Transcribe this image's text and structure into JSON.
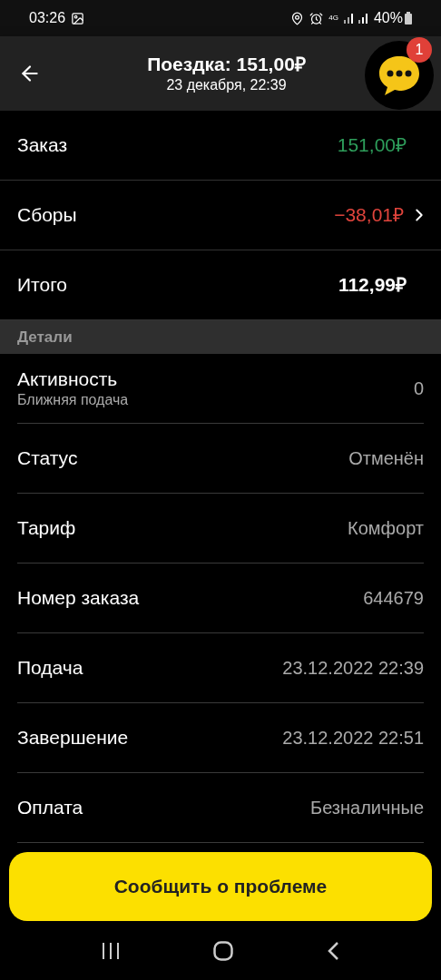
{
  "status_bar": {
    "time": "03:26",
    "battery": "40%",
    "network": "4G"
  },
  "header": {
    "title": "Поездка: 151,00₽",
    "subtitle": "23 декабря, 22:39",
    "chat_badge": "1"
  },
  "summary": [
    {
      "label": "Заказ",
      "value": "151,00₽",
      "kind": "positive",
      "chevron": false
    },
    {
      "label": "Сборы",
      "value": "−38,01₽",
      "kind": "negative",
      "chevron": true
    },
    {
      "label": "Итого",
      "value": "112,99₽",
      "kind": "total",
      "chevron": false
    }
  ],
  "details": {
    "heading": "Детали",
    "rows": [
      {
        "label": "Активность",
        "sublabel": "Ближняя подача",
        "value": "0"
      },
      {
        "label": "Статус",
        "value": "Отменён"
      },
      {
        "label": "Тариф",
        "value": "Комфорт"
      },
      {
        "label": "Номер заказа",
        "value": "644679"
      },
      {
        "label": "Подача",
        "value": "23.12.2022 22:39"
      },
      {
        "label": "Завершение",
        "value": "23.12.2022 22:51"
      },
      {
        "label": "Оплата",
        "value": "Безналичные"
      }
    ]
  },
  "action_button": "Сообщить о проблеме"
}
